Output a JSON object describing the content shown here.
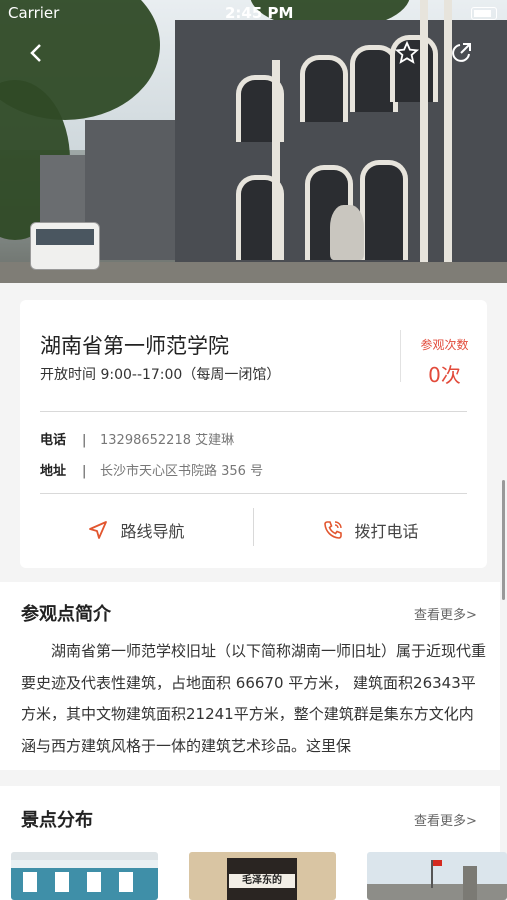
{
  "status_bar": {
    "carrier": "Carrier",
    "time": "2:45 PM"
  },
  "place": {
    "name": "湖南省第一师范学院",
    "hours": "开放时间  9:00--17:00（每周一闭馆）",
    "visits_label": "参观次数",
    "visits_value": "0次",
    "phone_label": "电话",
    "phone_value": "13298652218  艾建琳",
    "address_label": "地址",
    "address_value": "长沙市天心区书院路 356 号",
    "separator": "|"
  },
  "actions": {
    "navigate": "路线导航",
    "call": "拨打电话"
  },
  "intro": {
    "title": "参观点简介",
    "more": "查看更多>",
    "text": "湖南省第一师范学校旧址（以下简称湖南一师旧址）属于近现代重要史迹及代表性建筑，占地面积 66670 平方米， 建筑面积26343平方米，其中文物建筑面积21241平方米，整个建筑群是集东方文化内涵与西方建筑风格于一体的建筑艺术珍品。这里保"
  },
  "spots": {
    "title": "景点分布",
    "more": "查看更多>",
    "thumb_2_sign": "毛泽东的"
  },
  "colors": {
    "accent": "#e24b3b",
    "nav_icon": "#e2562f",
    "call_icon": "#e2562f"
  },
  "icons": {
    "back": "chevron-left-icon",
    "favorite": "star-icon",
    "share": "share-icon",
    "navigate": "navigation-arrow-icon",
    "call": "phone-icon"
  }
}
